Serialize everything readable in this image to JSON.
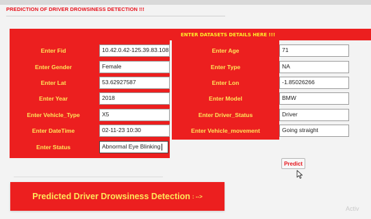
{
  "app": {
    "title": "PREDICTION OF DRIVER DROWSINESS DETECTION !!!"
  },
  "form": {
    "header": "ENTER DATASETS DETAILS HERE !!!",
    "left_fields": [
      {
        "label": "Enter Fid",
        "value": "10.42.0.42-125.39.83.108"
      },
      {
        "label": "Enter Gender",
        "value": "Female"
      },
      {
        "label": "Enter Lat",
        "value": "53.62927587"
      },
      {
        "label": "Enter Year",
        "value": "2018"
      },
      {
        "label": "Enter Vehicle_Type",
        "value": "X5"
      },
      {
        "label": "Enter DateTime",
        "value": "02-11-23 10:30"
      },
      {
        "label": "Enter Status",
        "value": "Abnormal Eye Blinking"
      }
    ],
    "right_fields": [
      {
        "label": "Enter Age",
        "value": "71"
      },
      {
        "label": "Enter Type",
        "value": "NA"
      },
      {
        "label": "Enter Lon",
        "value": "-1.85026266"
      },
      {
        "label": "Enter Model",
        "value": "BMW"
      },
      {
        "label": "Enter Driver_Status",
        "value": "Driver"
      },
      {
        "label": "Enter Vehicle_movement",
        "value": "Going straight"
      }
    ],
    "predict_label": "Predict"
  },
  "result": {
    "text": "Predicted Driver Drowsiness Detection",
    "arrow": ": -->"
  },
  "watermark": "Activ",
  "colors": {
    "panel_red": "#ec1f1f",
    "label_yellow": "#ffe65a",
    "title_red": "#e8101a"
  },
  "icons": {
    "cursor": "mouse-pointer-icon"
  }
}
